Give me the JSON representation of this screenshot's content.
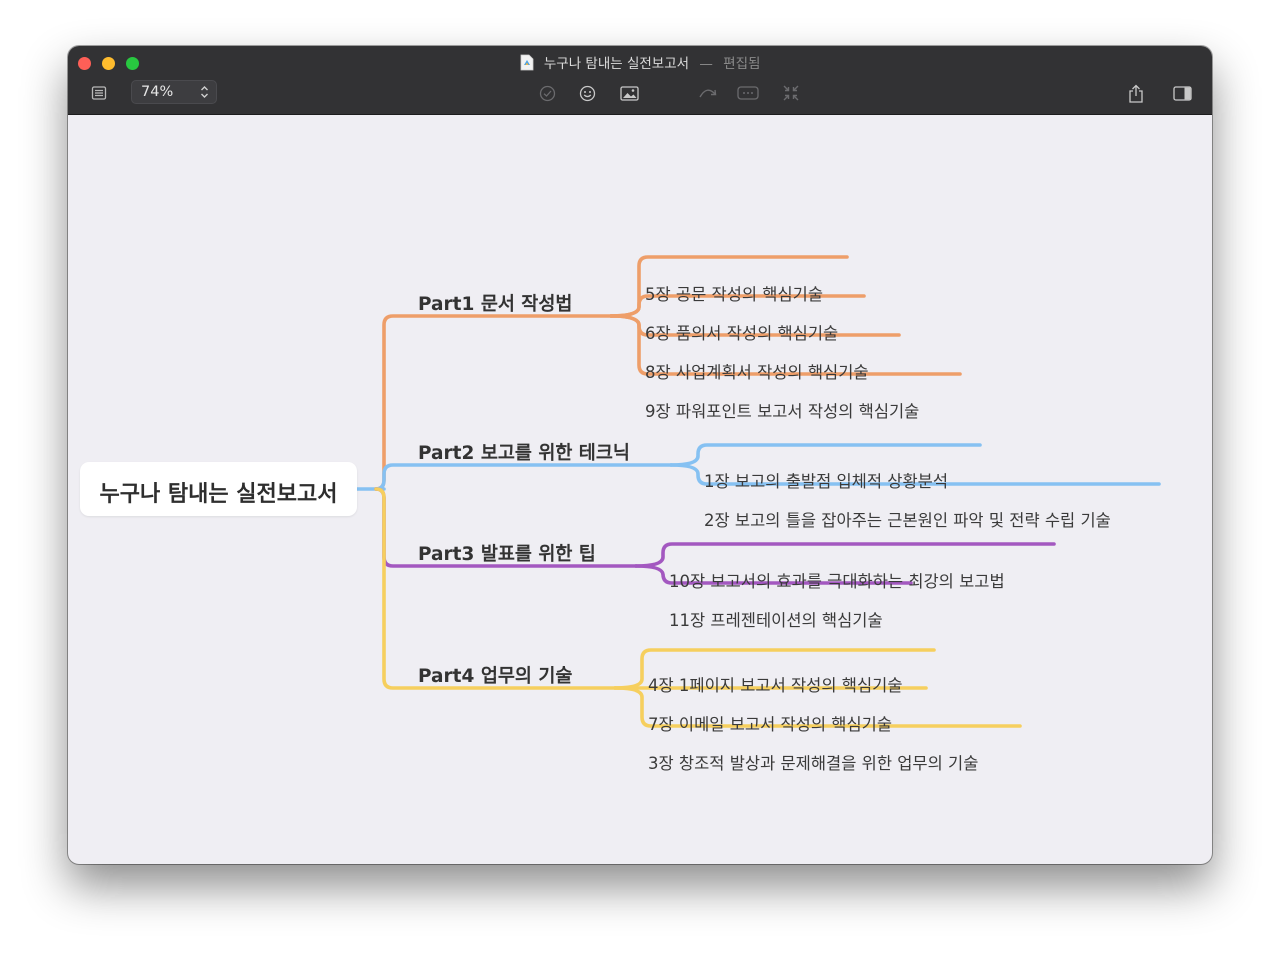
{
  "window": {
    "title": "누구나 탐내는 실전보고서",
    "status": "편집됨",
    "zoom": "74%"
  },
  "toolbar": {
    "icons": [
      "outline-icon",
      "checkbox-icon",
      "emoji-icon",
      "image-icon",
      "relationship-icon",
      "summary-icon",
      "collapse-icon",
      "share-icon",
      "sidebar-icon"
    ]
  },
  "mindmap": {
    "root": "누구나 탐내는 실전보고서",
    "branches": [
      {
        "label": "Part1 문서 작성법",
        "color": "#ee9e69",
        "children": [
          "5장 공문 작성의 핵심기술",
          "6장 품의서 작성의 핵심기술",
          "8장 사업계획서 작성의 핵심기술",
          "9장 파워포인트 보고서 작성의 핵심기술"
        ]
      },
      {
        "label": "Part2 보고를 위한 테크닉",
        "color": "#86c1f2",
        "children": [
          "1장 보고의 출발점 입체적 상황분석",
          "2장 보고의 틀을 잡아주는 근본원인 파악 및 전략 수립 기술"
        ]
      },
      {
        "label": "Part3 발표를 위한 팁",
        "color": "#a358c0",
        "children": [
          "10장 보고서의 효과를 극대화하는 최강의 보고법",
          "11장 프레젠테이션의 핵심기술"
        ]
      },
      {
        "label": "Part4 업무의 기술",
        "color": "#f6cf5e",
        "children": [
          "4장 1페이지 보고서 작성의 핵심기술",
          "7장 이메일 보고서 작성의 핵심기술",
          "3장 창조적 발상과 문제해결을 위한 업무의 기술"
        ]
      }
    ]
  }
}
